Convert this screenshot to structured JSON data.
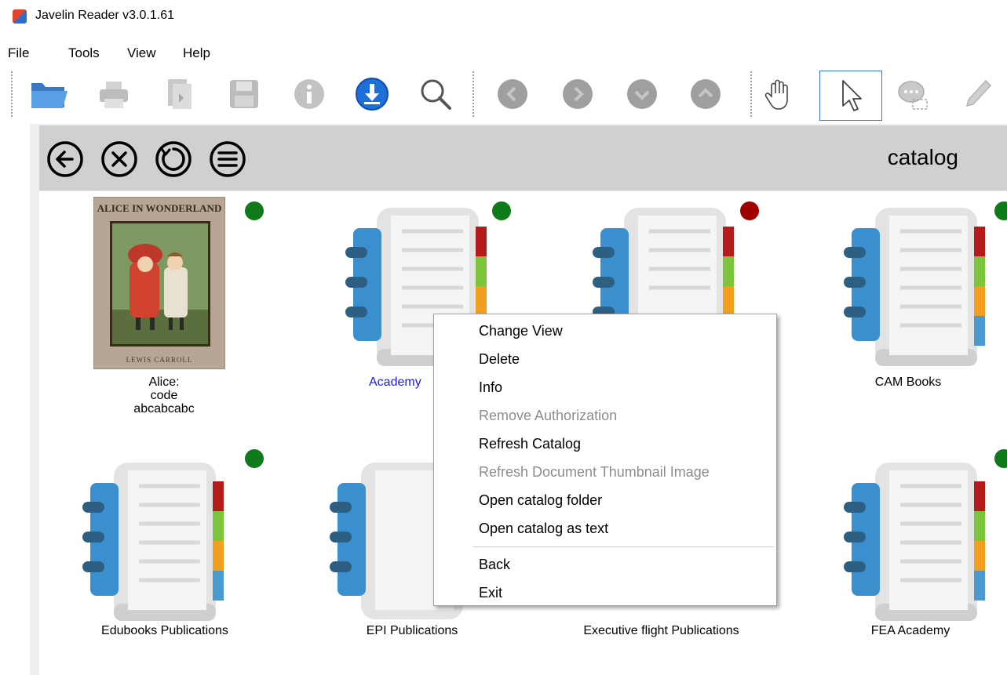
{
  "window": {
    "title": "Javelin Reader v3.0.1.61",
    "app_icon": "javelin-app-icon"
  },
  "menubar": {
    "items": [
      "File",
      "Tools",
      "View",
      "Help"
    ]
  },
  "toolbar": {
    "buttons": [
      {
        "name": "open-folder",
        "enabled": true
      },
      {
        "name": "print",
        "enabled": false
      },
      {
        "name": "add-document",
        "enabled": false
      },
      {
        "name": "save",
        "enabled": false
      },
      {
        "name": "info",
        "enabled": false
      },
      {
        "name": "download",
        "enabled": true
      },
      {
        "name": "search",
        "enabled": true
      },
      {
        "name": "previous-page",
        "enabled": false
      },
      {
        "name": "next-page",
        "enabled": false
      },
      {
        "name": "scroll-down",
        "enabled": false
      },
      {
        "name": "scroll-up",
        "enabled": false
      },
      {
        "name": "hand-tool",
        "enabled": true
      },
      {
        "name": "select-tool",
        "enabled": true,
        "active": true
      },
      {
        "name": "annotation-tool",
        "enabled": false
      },
      {
        "name": "highlighter-tool",
        "enabled": false
      }
    ]
  },
  "header": {
    "title": "catalog",
    "nav_buttons": [
      "back",
      "close",
      "refresh",
      "menu"
    ]
  },
  "catalog_items": [
    {
      "label": "Alice: code abcabcabc",
      "status_color": "#0f7a1a",
      "type": "book-cover",
      "cover_title": "ALICE IN WONDERLAND",
      "cover_author": "LEWIS CARROLL"
    },
    {
      "label": "Academy",
      "status_color": "#0f7a1a",
      "type": "catalog",
      "link": true
    },
    {
      "label": "",
      "status_color": "#a00000",
      "type": "catalog"
    },
    {
      "label": "CAM Books",
      "status_color": "#0f7a1a",
      "type": "catalog"
    },
    {
      "label": "Edubooks Publications",
      "status_color": "#0f7a1a",
      "type": "catalog"
    },
    {
      "label": "EPI Publications",
      "status_color": "",
      "type": "catalog"
    },
    {
      "label": "Executive flight Publications",
      "status_color": "",
      "type": "catalog"
    },
    {
      "label": "FEA Academy",
      "status_color": "#0f7a1a",
      "type": "catalog"
    }
  ],
  "context_menu": {
    "items": [
      {
        "label": "Change View",
        "enabled": true
      },
      {
        "label": "Delete",
        "enabled": true
      },
      {
        "label": "Info",
        "enabled": true
      },
      {
        "label": "Remove Authorization",
        "enabled": false
      },
      {
        "label": "Refresh Catalog",
        "enabled": true
      },
      {
        "label": "Refresh Document Thumbnail Image",
        "enabled": false
      },
      {
        "label": "Open catalog folder",
        "enabled": true
      },
      {
        "label": "Open catalog as text",
        "enabled": true
      },
      {
        "label": "Back",
        "enabled": true
      },
      {
        "label": "Exit",
        "enabled": true
      }
    ]
  },
  "colors": {
    "tab_red": "#b41c1c",
    "tab_green": "#7cc43a",
    "tab_orange": "#f0a01e",
    "tab_blue": "#4a9ad0",
    "binder_blue": "#3a8fcf",
    "status_green": "#0f7a1a",
    "status_red": "#a00000"
  }
}
